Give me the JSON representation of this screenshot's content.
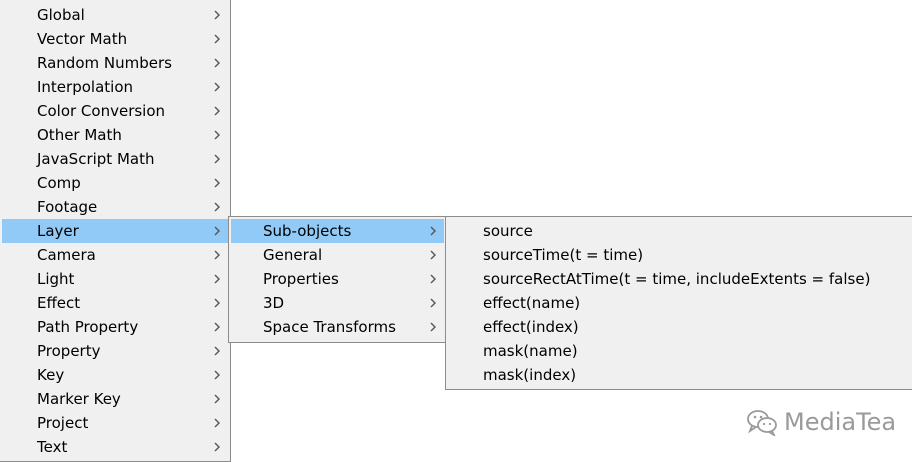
{
  "menus": {
    "main": {
      "items": [
        {
          "label": "Global"
        },
        {
          "label": "Vector Math"
        },
        {
          "label": "Random Numbers"
        },
        {
          "label": "Interpolation"
        },
        {
          "label": "Color Conversion"
        },
        {
          "label": "Other Math"
        },
        {
          "label": "JavaScript Math"
        },
        {
          "label": "Comp"
        },
        {
          "label": "Footage"
        },
        {
          "label": "Layer"
        },
        {
          "label": "Camera"
        },
        {
          "label": "Light"
        },
        {
          "label": "Effect"
        },
        {
          "label": "Path Property"
        },
        {
          "label": "Property"
        },
        {
          "label": "Key"
        },
        {
          "label": "Marker Key"
        },
        {
          "label": "Project"
        },
        {
          "label": "Text"
        }
      ],
      "highlighted": "Layer"
    },
    "layer_submenu": {
      "items": [
        {
          "label": "Sub-objects"
        },
        {
          "label": "General"
        },
        {
          "label": "Properties"
        },
        {
          "label": "3D"
        },
        {
          "label": "Space Transforms"
        }
      ],
      "highlighted": "Sub-objects"
    },
    "subobjects_submenu": {
      "items": [
        {
          "label": "source"
        },
        {
          "label": "sourceTime(t = time)"
        },
        {
          "label": "sourceRectAtTime(t = time, includeExtents = false)"
        },
        {
          "label": "effect(name)"
        },
        {
          "label": "effect(index)"
        },
        {
          "label": "mask(name)"
        },
        {
          "label": "mask(index)"
        }
      ]
    }
  },
  "icons": {
    "submenu_arrow": "chevron-right-icon",
    "watermark_logo": "wechat-icon"
  },
  "colors": {
    "menu_background": "#f0f0f0",
    "highlight": "#91c9f7",
    "border": "#8c8c8c",
    "watermark": "#9a9a9a"
  },
  "watermark": {
    "text": "MediaTea"
  }
}
